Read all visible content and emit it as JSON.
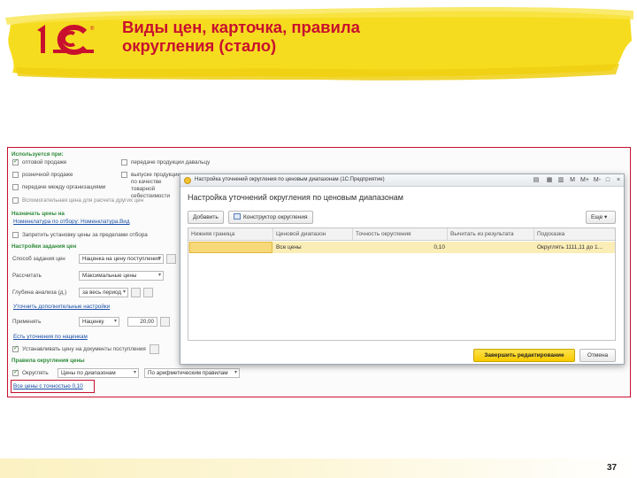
{
  "slide": {
    "title": "Виды цен, карточка, правила округления (стало)",
    "page_number": "37",
    "brand_color": "#c8102e",
    "accent_yellow": "#f5dc1e"
  },
  "bg_form": {
    "groups": {
      "used_for": "Используется при:",
      "assign_prices": "Назначать цены на",
      "price_calc": "Настройки задания цен",
      "rounding_rules": "Правила округления цены"
    },
    "checkboxes": [
      {
        "label": "оптовой продаже",
        "checked": true
      },
      {
        "label": "розничной продаже",
        "checked": false
      },
      {
        "label": "передаче между организациями",
        "checked": false
      },
      {
        "label": "Вспомогательная цена для расчета других цен",
        "checked": false
      },
      {
        "label": "передаче продукции давальцу",
        "checked": false
      },
      {
        "label": "выпуске продукции по качестве товарной себестоимости",
        "checked": false
      }
    ],
    "assign_filter_link": "Номенклатура по отбору: Номенклатура.Вид",
    "forbid_manual": "Запретить установку цены за пределами отбора",
    "method_label": "Способ задания цен",
    "method_value": "Наценка на цену поступления",
    "calc_label": "Рассчитать",
    "calc_value": "Максимальные цены",
    "depth_label": "Глубина анализа (д.)",
    "depth_value": "за весь период",
    "extra_link": "Уточнить дополнительные настройки",
    "apply_label": "Применять",
    "apply_value": "Наценку",
    "apply_amount": "20,00",
    "clarify_link": "Есть уточнения по наценкам",
    "set_price_docs": "Устанавливать цену на документы поступления",
    "round_label": "Округлять",
    "round_mode": "Цены по диапазонам",
    "round_rule": "По арифметическим правилам",
    "round_link": "Все цены с точностью 0,10"
  },
  "modal": {
    "window_title": "Настройка уточнений округления по ценовым диапазонам (1С:Предприятие)",
    "heading": "Настройка уточнений округления по ценовым диапазонам",
    "titlebar_buttons": [
      "M",
      "M+",
      "M-",
      "□",
      "×"
    ],
    "toolbar": {
      "add": "Добавить",
      "constructor": "Конструктор округления",
      "more": "Еще"
    },
    "columns": [
      "Нижняя граница",
      "Ценовой диапазон",
      "Точность округления",
      "Вычитать из результата",
      "Подсказка"
    ],
    "rows": [
      {
        "lower_bound": "",
        "range": "Все цены",
        "precision": "0,10",
        "subtract": "",
        "hint": "Округлять 1111,11 до 1..."
      }
    ],
    "finish_button": "Завершить редактирование",
    "cancel_button": "Отмена"
  }
}
